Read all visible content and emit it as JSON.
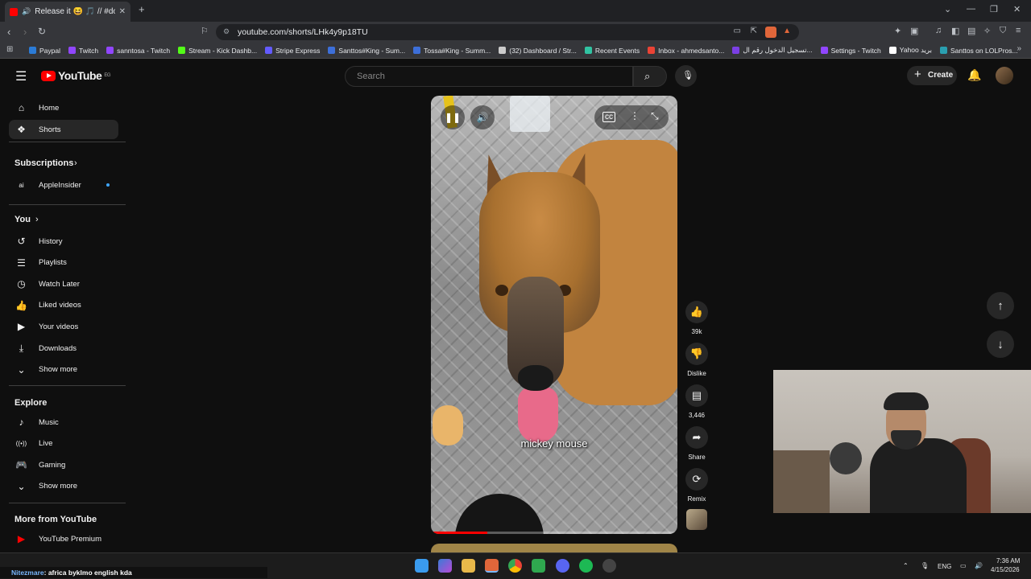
{
  "browser": {
    "tab_title": "Release it 😆 🎵 // #dogs #do",
    "url": "youtube.com/shorts/LHk4y9p18TU",
    "bookmarks": [
      {
        "label": "Paypal",
        "color": "#2b7bd6"
      },
      {
        "label": "Twitch",
        "color": "#9146ff"
      },
      {
        "label": "sanntosa - Twitch",
        "color": "#9146ff"
      },
      {
        "label": "Stream - Kick Dashb...",
        "color": "#53fc18"
      },
      {
        "label": "Stripe Express",
        "color": "#635bff"
      },
      {
        "label": "Santtos#King - Sum...",
        "color": "#3d6fd9"
      },
      {
        "label": "Tossa#King - Summ...",
        "color": "#3d6fd9"
      },
      {
        "label": "(32) Dashboard / Str...",
        "color": "#cccccc"
      },
      {
        "label": "Recent Events",
        "color": "#31c3a2"
      },
      {
        "label": "Inbox - ahmedsanto...",
        "color": "#ea4335"
      },
      {
        "label": "تسجيل الدخول رقم ال...",
        "color": "#7b3fe4"
      },
      {
        "label": "Settings - Twitch",
        "color": "#9146ff"
      },
      {
        "label": "Yahoo بريد",
        "color": "#ffffff"
      },
      {
        "label": "Santtos on LOLPros...",
        "color": "#2a9fb0"
      }
    ]
  },
  "youtube": {
    "logo_text": "YouTube",
    "logo_region": "EG",
    "search_placeholder": "Search",
    "create_label": "Create"
  },
  "sidebar": {
    "main": [
      {
        "label": "Home",
        "icon": "home-icon",
        "glyph": "⌂"
      },
      {
        "label": "Shorts",
        "icon": "shorts-icon",
        "glyph": "❖"
      }
    ],
    "subscriptions_title": "Subscriptions",
    "subscriptions": [
      {
        "label": "AppleInsider",
        "icon": "appleinsider-icon",
        "glyph": "ai"
      }
    ],
    "you_title": "You",
    "you": [
      {
        "label": "History",
        "icon": "history-icon",
        "glyph": "↺"
      },
      {
        "label": "Playlists",
        "icon": "playlists-icon",
        "glyph": "☰"
      },
      {
        "label": "Watch Later",
        "icon": "clock-icon",
        "glyph": "◷"
      },
      {
        "label": "Liked videos",
        "icon": "thumbs-up-icon",
        "glyph": "👍"
      },
      {
        "label": "Your videos",
        "icon": "your-videos-icon",
        "glyph": "▶"
      },
      {
        "label": "Downloads",
        "icon": "download-icon",
        "glyph": "⤓"
      },
      {
        "label": "Show more",
        "icon": "chevron-down-icon",
        "glyph": "⌄"
      }
    ],
    "explore_title": "Explore",
    "explore": [
      {
        "label": "Music",
        "icon": "music-icon",
        "glyph": "♪"
      },
      {
        "label": "Live",
        "icon": "live-icon",
        "glyph": "((•))"
      },
      {
        "label": "Gaming",
        "icon": "gaming-icon",
        "glyph": "🎮"
      },
      {
        "label": "Show more",
        "icon": "chevron-down-icon",
        "glyph": "⌄"
      }
    ],
    "more_title": "More from YouTube",
    "more": [
      {
        "label": "YouTube Premium",
        "icon": "youtube-premium-icon",
        "glyph": "▶"
      }
    ]
  },
  "short": {
    "caption": "mickey mouse",
    "progress": 0.23,
    "actions": {
      "like_count": "39k",
      "dislike_label": "Dislike",
      "comment_count": "3,446",
      "share_label": "Share",
      "remix_label": "Remix"
    }
  },
  "taskbar": {
    "now_playing_user": "Nitezmare",
    "now_playing_text": ": africa byklmo english kda",
    "language": "ENG",
    "time": "7:36 AM",
    "date": "4/15/2026"
  }
}
